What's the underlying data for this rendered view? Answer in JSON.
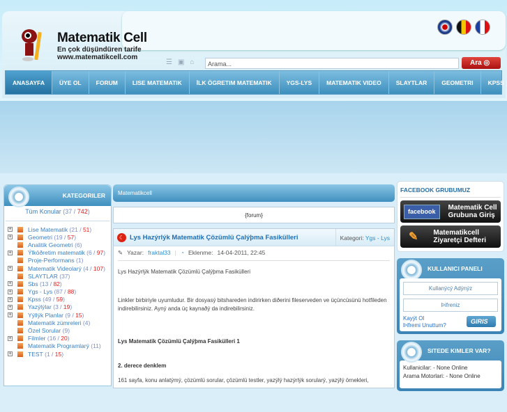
{
  "header": {
    "brand": "Matematik Cell",
    "tagline": "En çok düşündüren tarife",
    "url": "www.matematikcell.com",
    "search_placeholder": "Arama...",
    "search_button": "Ara",
    "flags": [
      "english-flag-icon",
      "german-flag-icon",
      "french-flag-icon"
    ]
  },
  "nav": [
    "ANASAYFA",
    "ÜYE OL",
    "FORUM",
    "LISE MATEMATIK",
    "İLK ÖGRETIM MATEMATIK",
    "YGS-LYS",
    "MATEMATIK VIDEO",
    "SLAYTLAR",
    "GEOMETRI",
    "KPSS"
  ],
  "categories": {
    "title": "KATEGORILER",
    "all": {
      "label": "Tüm Konular",
      "a": "37",
      "b": "742"
    },
    "items": [
      {
        "label": "Lise Matematik",
        "a": "21",
        "b": "51",
        "exp": true
      },
      {
        "label": "Geometri",
        "a": "19",
        "b": "57",
        "exp": true
      },
      {
        "label": "Analitik Geometri",
        "a": "6",
        "exp": false
      },
      {
        "label": "Ýlköðretim matematik",
        "a": "6",
        "b": "97",
        "exp": true
      },
      {
        "label": "Proje-Performans",
        "a": "1",
        "exp": false
      },
      {
        "label": "Matematik Videolarý",
        "a": "4",
        "b": "107",
        "exp": true
      },
      {
        "label": "SLAYTLAR",
        "a": "37",
        "exp": false
      },
      {
        "label": "Sbs",
        "a": "13",
        "b": "82",
        "exp": true
      },
      {
        "label": "Ygs - Lys",
        "a": "87",
        "b": "88",
        "exp": true
      },
      {
        "label": "Kpss",
        "a": "49",
        "b": "59",
        "exp": true
      },
      {
        "label": "Yazýlýlar",
        "a": "3",
        "b": "19",
        "exp": true
      },
      {
        "label": "Yýllýk Planlar",
        "a": "9",
        "b": "15",
        "exp": true
      },
      {
        "label": "Matematik zümreleri",
        "a": "4",
        "exp": false
      },
      {
        "label": "Özel Sorular",
        "a": "9",
        "exp": false
      },
      {
        "label": "Filmler",
        "a": "16",
        "b": "20",
        "exp": true
      },
      {
        "label": "Matematik Programlarý",
        "a": "11",
        "exp": false
      },
      {
        "label": "TEST",
        "a": "1",
        "b": "15",
        "exp": true
      }
    ]
  },
  "center": {
    "header": "Matematikcell",
    "forum": "{forum}",
    "article": {
      "title": "Lys Hazýrlýk Matematik Çözümlü Çalýþma Fasikülleri",
      "category_label": "Kategori:",
      "category": "Ygs - Lys",
      "author_label": "Yazar:",
      "author": "fraktal33",
      "date_label": "Eklenme:",
      "date": "14-04-2011, 22:45",
      "p1": "Lys Hazýrlýk Matematik Çözümlü Çalýþma Fasikülleri",
      "p2": "Linkler birbiriyle uyumludur. Bir dosyasý bitshareden indirirken diðerini fileserveden ve üçüncüsünü hotfileden indirebilirsiniz. Ayný anda üç kaynaðý da indirebilirsiniz.",
      "p3": "Lys Matematik Çözümlü Çalýþma Fasikülleri 1",
      "p4": "2. derece denklem",
      "p5": "161 sayfa, konu anlatýmý, çözümlü sorular, çözümlü testler, yazýlý hazýrlýk sorularý, yazýlý örnekleri,"
    }
  },
  "right": {
    "facebook_title": "FACEBOOK GRUBUMUZ",
    "fb_logo": "facebook",
    "fb_text1": "Matematik Cell",
    "fb_text2": "Grubuna Giriş",
    "guest1": "Matematikcell",
    "guest2": "Ziyaretçi Defteri",
    "panel_title": "KULLANICI PANELI",
    "username": "Kullanýcý Adýnýz",
    "password": "Þifreniz",
    "register": "Kayýt Ol",
    "forgot": "Þifremi Unuttum?",
    "login": "GIRIS",
    "who_title": "SITEDE KIMLER VAR?",
    "users": "Kullanicilar: - None Online",
    "bots": "Arama Motorlari: - None Online"
  }
}
